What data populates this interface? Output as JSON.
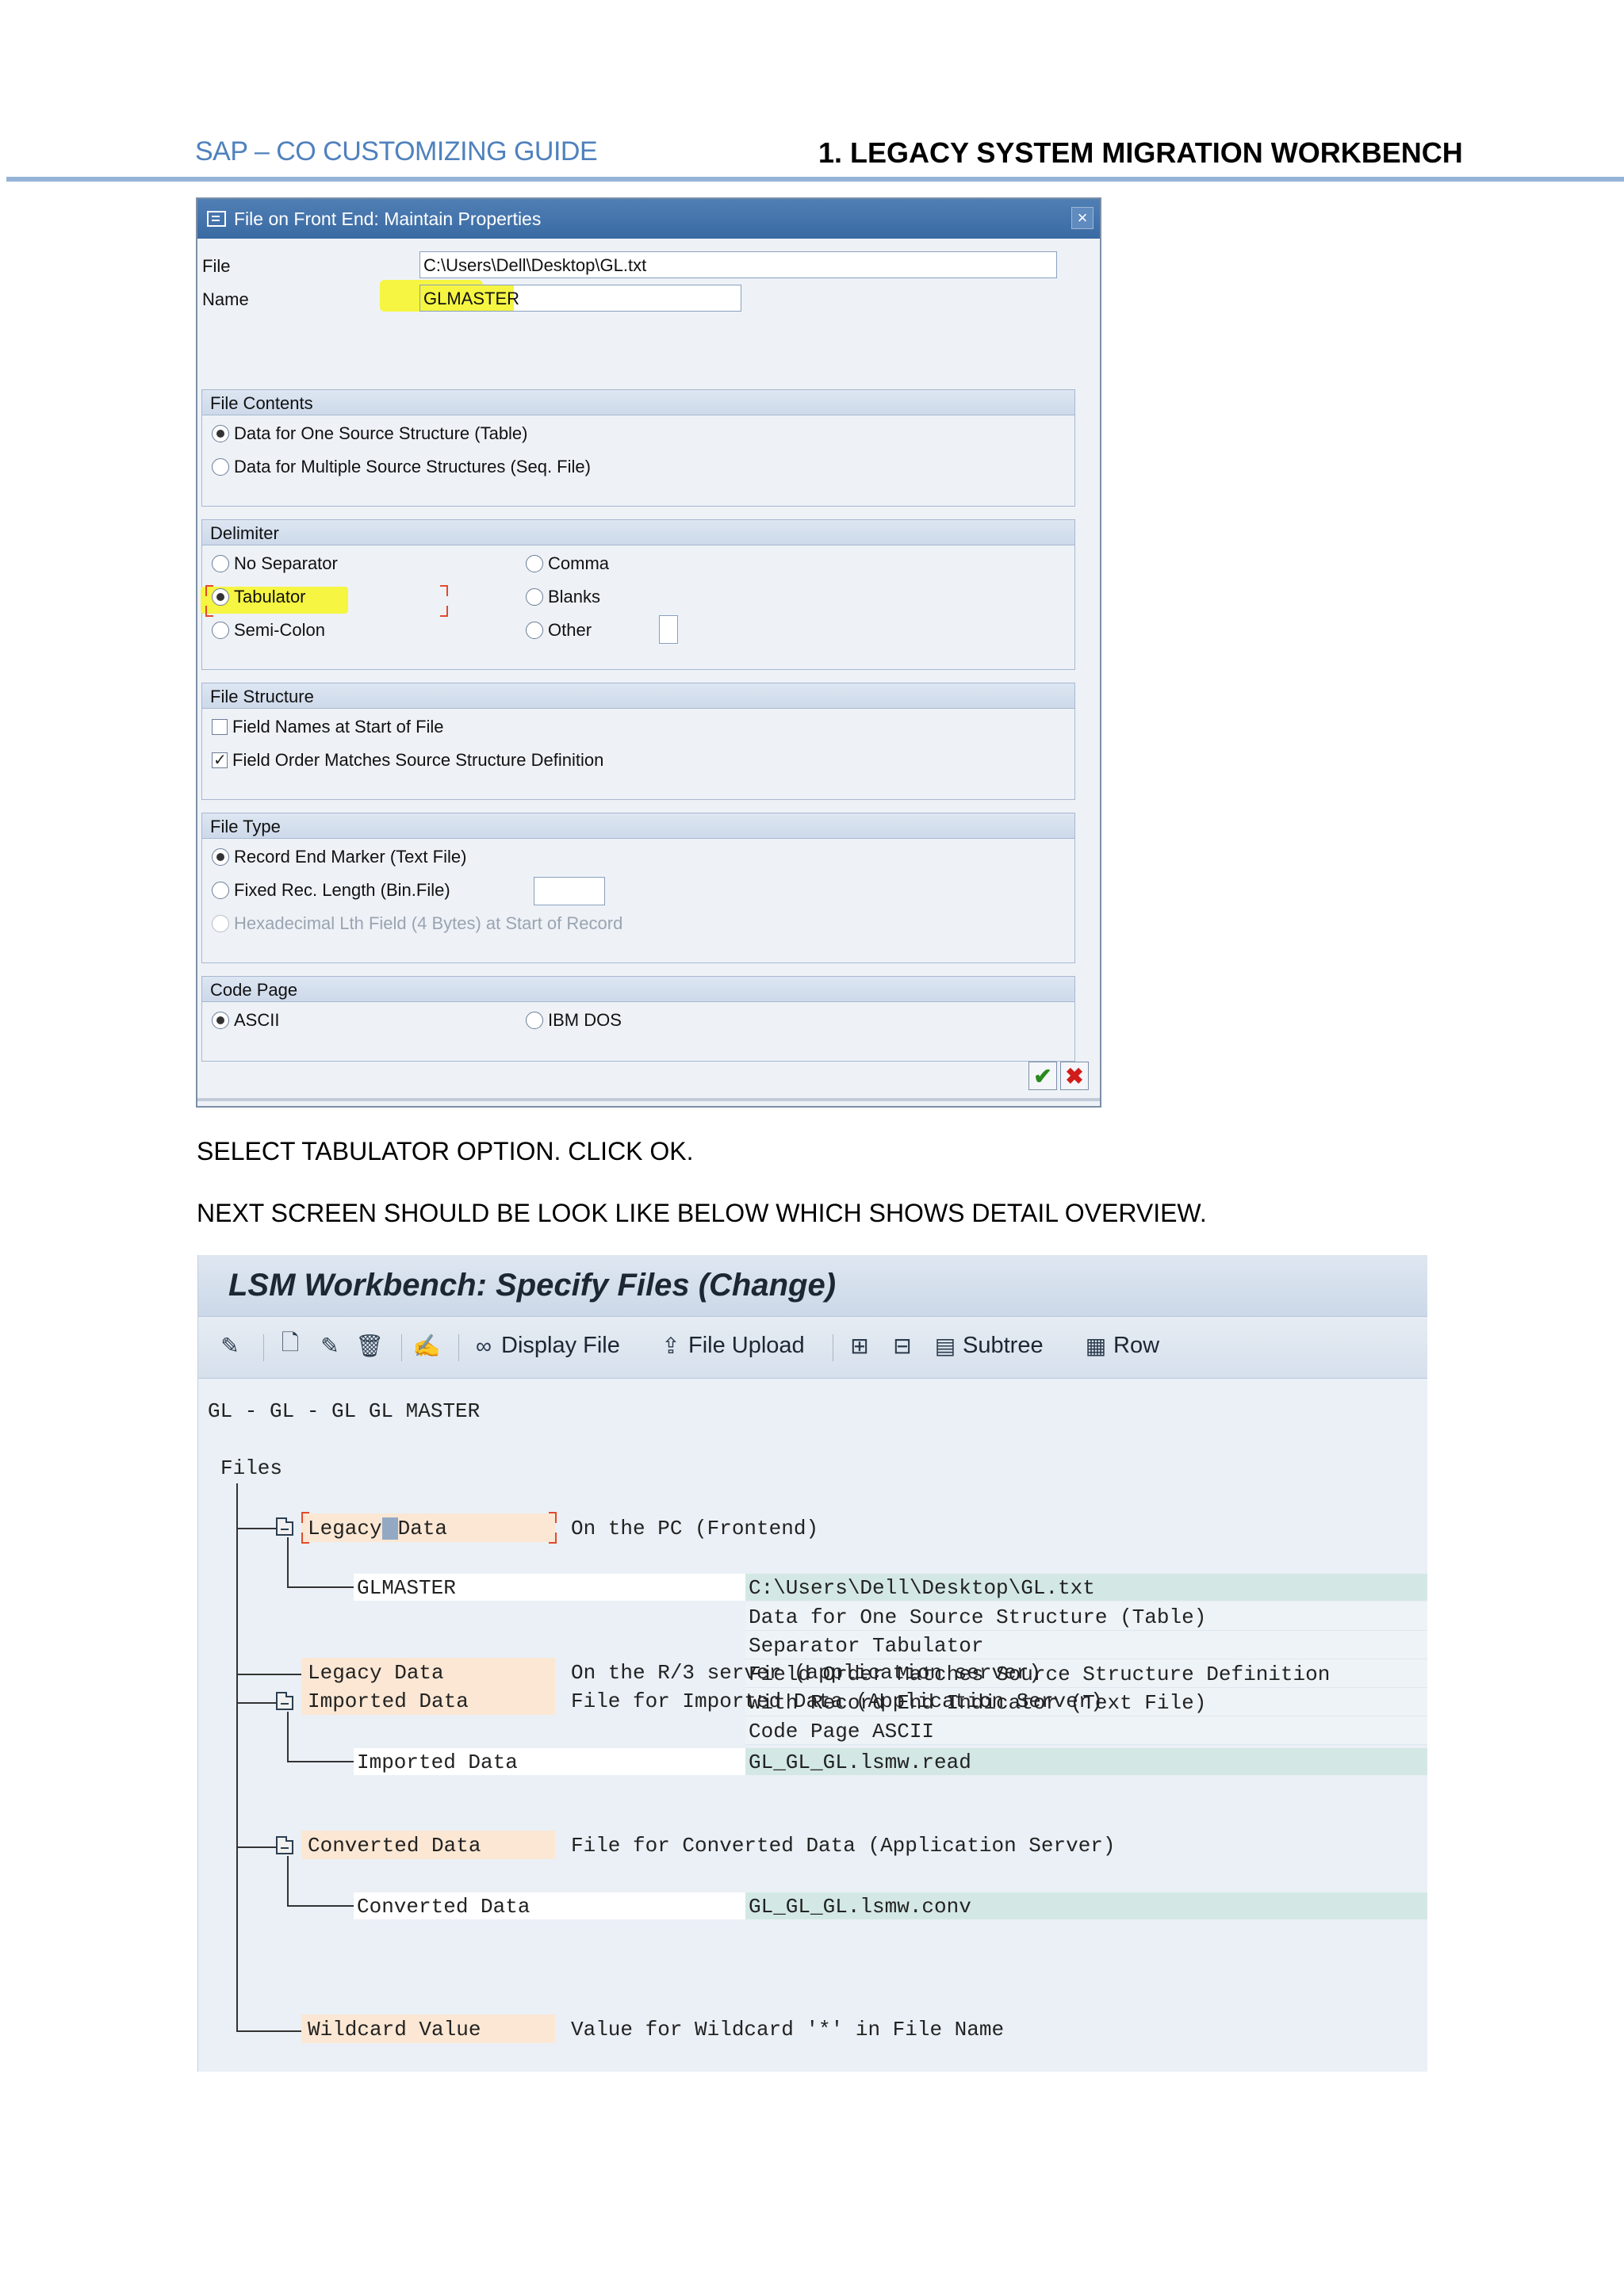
{
  "header": {
    "left": "SAP – CO CUSTOMIZING GUIDE",
    "right": "1. LEGACY SYSTEM MIGRATION WORKBENCH"
  },
  "dialog": {
    "title": "File on Front End: Maintain Properties",
    "file_label": "File",
    "file_value": "C:\\Users\\Dell\\Desktop\\GL.txt",
    "name_label": "Name",
    "name_value": "GLMASTER",
    "file_contents": {
      "title": "File Contents",
      "options": [
        "Data for One Source Structure (Table)",
        "Data for Multiple Source Structures (Seq. File)"
      ]
    },
    "delimiter": {
      "title": "Delimiter",
      "left": [
        "No Separator",
        "Tabulator",
        "Semi-Colon"
      ],
      "right": [
        "Comma",
        "Blanks",
        "Other"
      ]
    },
    "file_structure": {
      "title": "File Structure",
      "options": [
        "Field Names at Start of File",
        "Field Order Matches Source Structure Definition"
      ]
    },
    "file_type": {
      "title": "File Type",
      "options": [
        "Record End Marker (Text File)",
        "Fixed Rec. Length (Bin.File)",
        "Hexadecimal Lth Field (4 Bytes) at Start of Record"
      ]
    },
    "code_page": {
      "title": "Code Page",
      "options": [
        "ASCII",
        "IBM DOS"
      ]
    },
    "ok_symbol": "✔",
    "cancel_symbol": "✖"
  },
  "instructions": {
    "line1": "SELECT TABULATOR OPTION. CLICK OK.",
    "line2": "NEXT SCREEN SHOULD BE LOOK LIKE BELOW WHICH SHOWS DETAIL OVERVIEW."
  },
  "lsm": {
    "title": "LSM Workbench: Specify Files (Change)",
    "toolbar": {
      "display_file": "Display File",
      "file_upload": "File Upload",
      "subtree": "Subtree",
      "row": "Row"
    },
    "path": "GL - GL - GL GL MASTER",
    "files_label": "Files",
    "legacy_pc": {
      "label_a": "Legacy",
      "label_b": "Data",
      "desc": "On the PC (Frontend)"
    },
    "glmaster": {
      "name": "GLMASTER",
      "lines": [
        "C:\\Users\\Dell\\Desktop\\GL.txt",
        "Data for One Source Structure (Table)",
        "Separator Tabulator",
        "Field Order Matches Source Structure Definition",
        "With Record End Indicator (Text File)",
        "Code Page ASCII"
      ]
    },
    "legacy_server": {
      "label": "Legacy Data",
      "desc": "On the R/3 server (application server)"
    },
    "imported": {
      "label": "Imported Data",
      "desc": "File for Imported Data (Application Server)",
      "child": "Imported Data",
      "value": "GL_GL_GL.lsmw.read"
    },
    "converted": {
      "label": "Converted Data",
      "desc": "File for Converted Data (Application Server)",
      "child": "Converted Data",
      "value": "GL_GL_GL.lsmw.conv"
    },
    "wildcard": {
      "label": "Wildcard Value",
      "desc": "Value for Wildcard '*' in File Name"
    }
  },
  "colors": {
    "header_blue": "#4f81bd",
    "highlight": "#f5f542",
    "sap_title": "#3a6aa3",
    "node_bg": "#fbe7d3",
    "value_bg": "#d3e8e4"
  }
}
